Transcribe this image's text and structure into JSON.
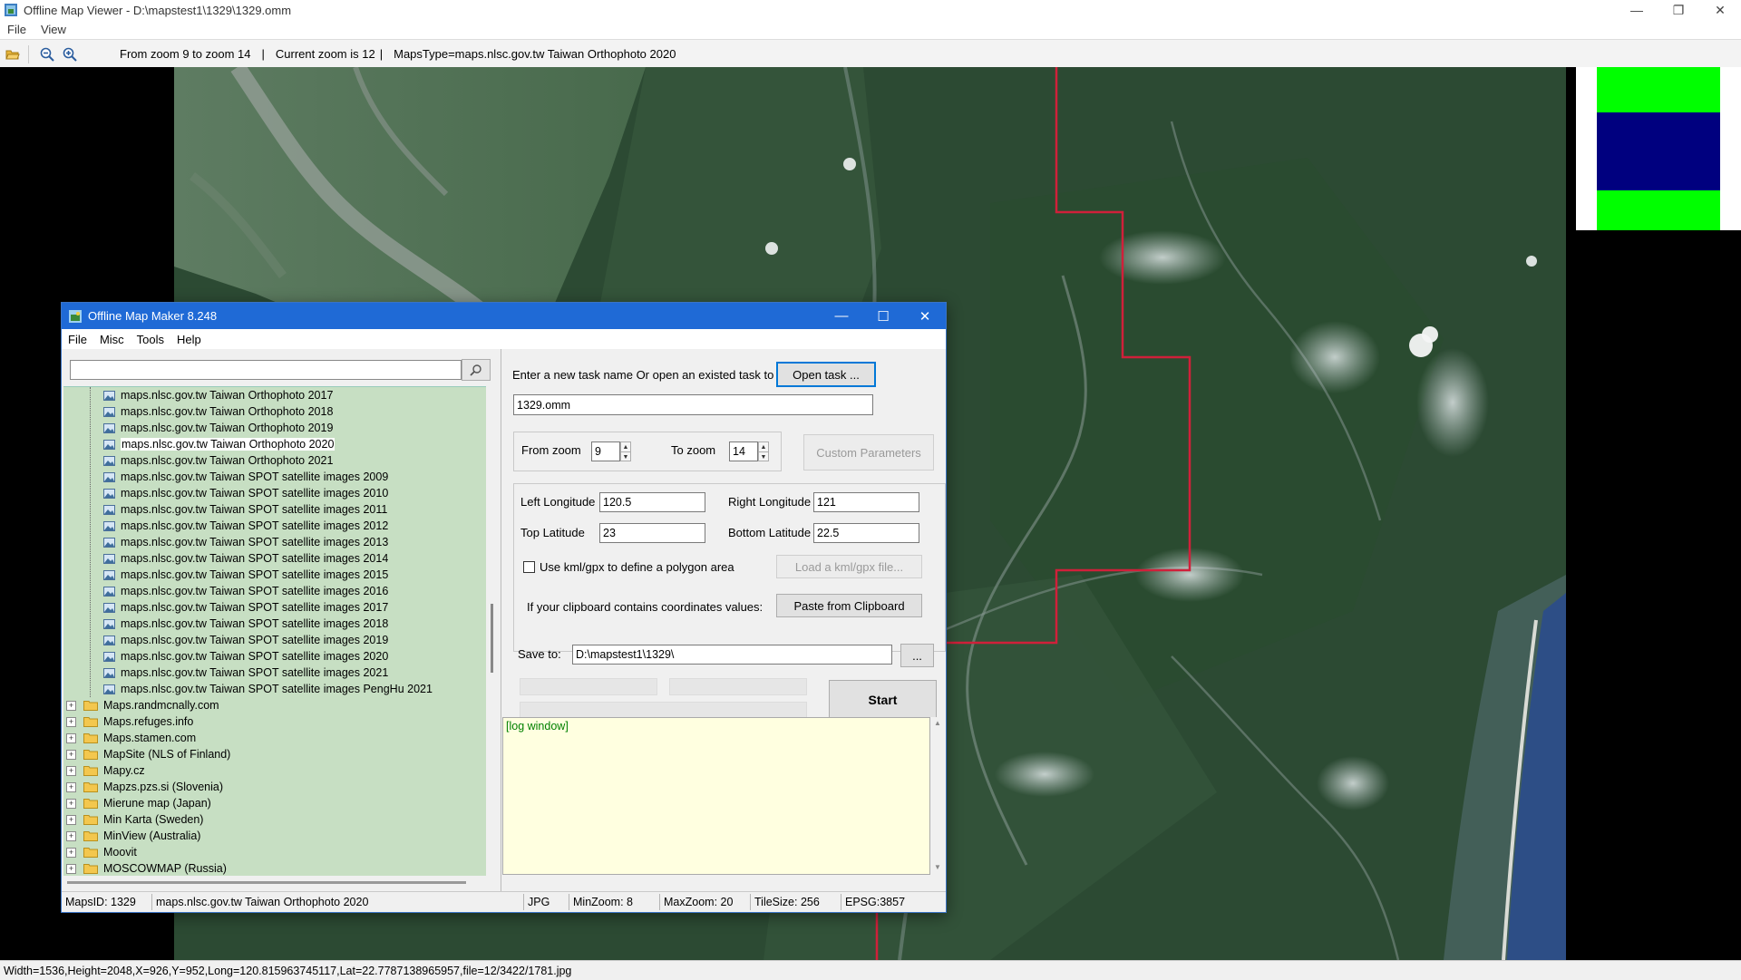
{
  "window": {
    "title": "Offline Map Viewer - D:\\mapstest1\\1329\\1329.omm",
    "menu": [
      "File",
      "View"
    ],
    "caption_buttons": {
      "minimize": "—",
      "restore": "❐",
      "close": "✕"
    }
  },
  "toolbar": {
    "icons": [
      "open-folder-icon",
      "zoom-out-icon",
      "zoom-in-icon"
    ],
    "zoom_range": "From zoom 9 to zoom 14",
    "current_zoom": "Current zoom is 12",
    "maps_type": "MapsType=maps.nlsc.gov.tw Taiwan Orthophoto 2020",
    "separator": "|"
  },
  "map": {
    "boundary_color": "#d0203a",
    "minimap_colors": {
      "top": "#00ff00",
      "middle": "#00007f",
      "bottom": "#00ff00"
    }
  },
  "status_bar": {
    "text": "Width=1536,Height=2048,X=926,Y=952,Long=120.815963745117,Lat=22.7787138965957,file=12/3422/1781.jpg"
  },
  "dialog": {
    "title": "Offline Map Maker 8.248",
    "menu": [
      "File",
      "Misc",
      "Tools",
      "Help"
    ],
    "caption_buttons": {
      "minimize": "—",
      "maximize": "☐",
      "close": "✕"
    },
    "search": {
      "value": "",
      "icon": "search-icon"
    },
    "tree": {
      "map_items": [
        "maps.nlsc.gov.tw Taiwan Orthophoto 2017",
        "maps.nlsc.gov.tw Taiwan Orthophoto 2018",
        "maps.nlsc.gov.tw Taiwan Orthophoto 2019",
        "maps.nlsc.gov.tw Taiwan Orthophoto 2020",
        "maps.nlsc.gov.tw Taiwan Orthophoto 2021",
        "maps.nlsc.gov.tw Taiwan SPOT satellite images 2009",
        "maps.nlsc.gov.tw Taiwan SPOT satellite images 2010",
        "maps.nlsc.gov.tw Taiwan SPOT satellite images 2011",
        "maps.nlsc.gov.tw Taiwan SPOT satellite images 2012",
        "maps.nlsc.gov.tw Taiwan SPOT satellite images 2013",
        "maps.nlsc.gov.tw Taiwan SPOT satellite images 2014",
        "maps.nlsc.gov.tw Taiwan SPOT satellite images 2015",
        "maps.nlsc.gov.tw Taiwan SPOT satellite images 2016",
        "maps.nlsc.gov.tw Taiwan SPOT satellite images 2017",
        "maps.nlsc.gov.tw Taiwan SPOT satellite images 2018",
        "maps.nlsc.gov.tw Taiwan SPOT satellite images 2019",
        "maps.nlsc.gov.tw Taiwan SPOT satellite images 2020",
        "maps.nlsc.gov.tw Taiwan SPOT satellite images 2021",
        "maps.nlsc.gov.tw Taiwan SPOT satellite images PengHu 2021"
      ],
      "selected_item": "maps.nlsc.gov.tw Taiwan Orthophoto 2020",
      "folders": [
        "Maps.randmcnally.com",
        "Maps.refuges.info",
        "Maps.stamen.com",
        "MapSite (NLS of Finland)",
        "Mapy.cz",
        "Mapzs.pzs.si (Slovenia)",
        "Mierune map (Japan)",
        "Min Karta (Sweden)",
        "MinView (Australia)",
        "Moovit",
        "MOSCOWMAP (Russia)"
      ],
      "expander_symbol": "+"
    },
    "task": {
      "prompt": "Enter a new task name Or open an existed task to continue:",
      "open_button": "Open task ...",
      "name_value": "1329.omm"
    },
    "zoom": {
      "from_label": "From zoom",
      "from_value": "9",
      "to_label": "To zoom",
      "to_value": "14",
      "custom_button": "Custom Parameters"
    },
    "coords": {
      "left_lon_label": "Left Longitude",
      "left_lon": "120.5",
      "right_lon_label": "Right Longitude",
      "right_lon": "121",
      "top_lat_label": "Top Latitude",
      "top_lat": "23",
      "bottom_lat_label": "Bottom Latitude",
      "bottom_lat": "22.5"
    },
    "kml": {
      "checkbox_label": "Use kml/gpx to define a polygon area",
      "checked": false,
      "load_button": "Load a kml/gpx file..."
    },
    "clipboard": {
      "label": "If your clipboard contains coordinates values:",
      "paste_button": "Paste from Clipboard"
    },
    "save": {
      "label": "Save to:",
      "path": "D:\\mapstest1\\1329\\",
      "browse_button": "..."
    },
    "start_button": "Start",
    "log_label": "[log window]",
    "status": {
      "maps_id": "MapsID: 1329",
      "maps_name": "maps.nlsc.gov.tw Taiwan Orthophoto 2020",
      "format": "JPG",
      "min_zoom": "MinZoom: 8",
      "max_zoom": "MaxZoom: 20",
      "tile_size": "TileSize: 256",
      "epsg": "EPSG:3857"
    }
  }
}
